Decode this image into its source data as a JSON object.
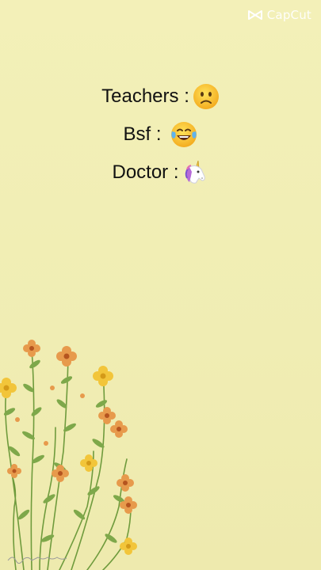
{
  "watermark": {
    "label": "CapCut",
    "icon": "capcut-logo-icon"
  },
  "lines": [
    {
      "label": "Teachers :",
      "emoji": "slightly-frowning-face-icon"
    },
    {
      "label": "Bsf :",
      "emoji": "tears-of-joy-face-icon"
    },
    {
      "label": "Doctor :",
      "emoji": "unicorn-icon"
    }
  ],
  "colors": {
    "background": "#f1eeb4",
    "text": "#111111",
    "flower_orange": "#e79a4c",
    "flower_yellow": "#f2c53a",
    "stem_green": "#6f9b3d"
  }
}
